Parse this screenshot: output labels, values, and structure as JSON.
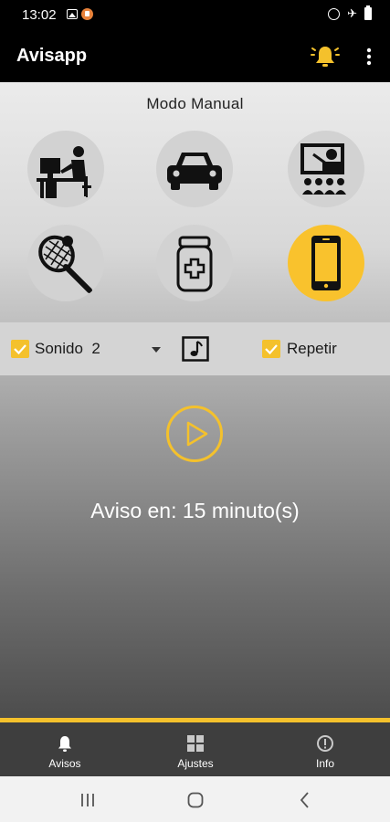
{
  "status_bar": {
    "time": "13:02"
  },
  "app_bar": {
    "title": "Avisapp"
  },
  "mode": {
    "title": "Modo Manual",
    "buttons": [
      {
        "name": "office",
        "active": false
      },
      {
        "name": "car",
        "active": false
      },
      {
        "name": "classroom",
        "active": false
      },
      {
        "name": "tennis",
        "active": false
      },
      {
        "name": "medicine",
        "active": false
      },
      {
        "name": "phone",
        "active": true
      }
    ]
  },
  "options": {
    "sound_label": "Sonido  2",
    "sound_checked": true,
    "repeat_label": "Repetir",
    "repeat_checked": true
  },
  "notice": {
    "text": "Aviso en: 15 minuto(s)"
  },
  "bottom_nav": {
    "items": [
      {
        "label": "Avisos",
        "icon": "bell-icon",
        "selected": true
      },
      {
        "label": "Ajustes",
        "icon": "grid-icon",
        "selected": false
      },
      {
        "label": "Info",
        "icon": "info-icon",
        "selected": false
      }
    ]
  },
  "colors": {
    "accent": "#f4c12c",
    "app_bar": "#000000",
    "nav_bg": "#3e3e3e"
  }
}
